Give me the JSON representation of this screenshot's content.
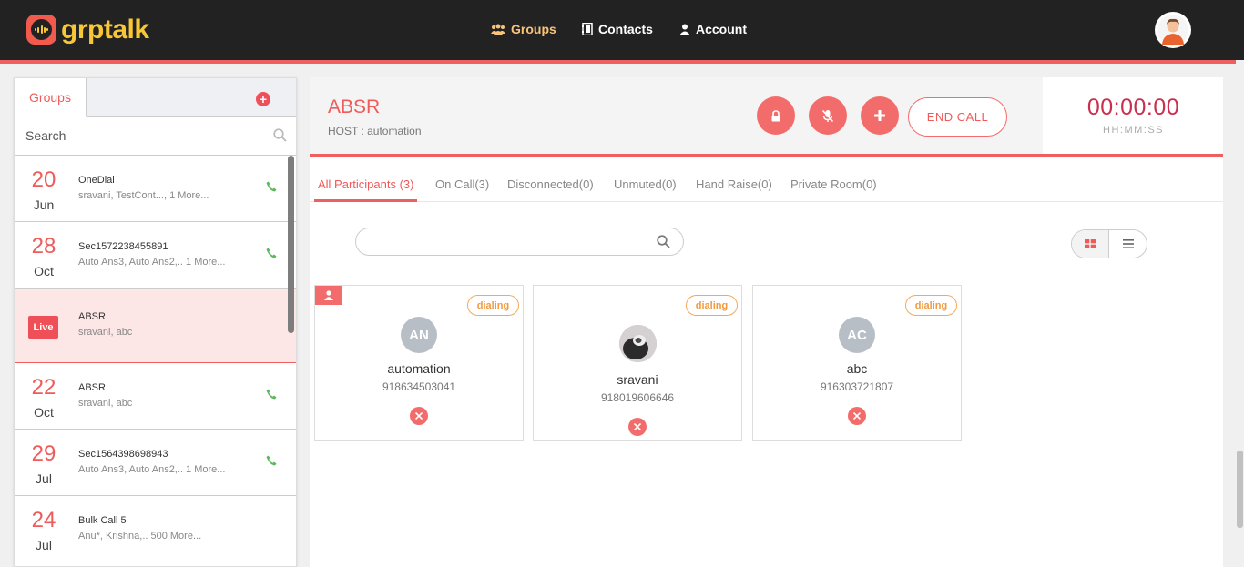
{
  "app": {
    "name": "grptalk"
  },
  "nav": {
    "groups": "Groups",
    "contacts": "Contacts",
    "account": "Account"
  },
  "sidebar": {
    "tab_label": "Groups",
    "search_placeholder": "Search",
    "items": [
      {
        "day": "20",
        "month": "Jun",
        "name": "OneDial",
        "members": "sravani, TestCont..., 1 More..."
      },
      {
        "day": "28",
        "month": "Oct",
        "name": "Sec1572238455891",
        "members": "Auto Ans3, Auto Ans2,.. 1 More..."
      },
      {
        "badge": "Live",
        "name": "ABSR",
        "members": "sravani, abc"
      },
      {
        "day": "22",
        "month": "Oct",
        "name": "ABSR",
        "members": "sravani, abc"
      },
      {
        "day": "29",
        "month": "Jul",
        "name": "Sec1564398698943",
        "members": "Auto Ans3, Auto Ans2,.. 1 More..."
      },
      {
        "day": "24",
        "month": "Jul",
        "name": "Bulk Call 5",
        "members": "Anu*, Krishna,.. 500 More..."
      }
    ]
  },
  "call": {
    "title": "ABSR",
    "host": "HOST : automation",
    "end_call": "END CALL",
    "timer": "00:00:00",
    "timer_label": "HH:MM:SS"
  },
  "participant_tabs": [
    "All Participants (3)",
    "On Call(3)",
    "Disconnected(0)",
    "Unmuted(0)",
    "Hand Raise(0)",
    "Private Room(0)"
  ],
  "participants": [
    {
      "initials": "AN",
      "name": "automation",
      "phone": "918634503041",
      "status": "dialing",
      "is_host": true
    },
    {
      "name": "sravani",
      "phone": "918019606646",
      "status": "dialing",
      "has_photo": true
    },
    {
      "initials": "AC",
      "name": "abc",
      "phone": "916303721807",
      "status": "dialing"
    }
  ],
  "colors": {
    "accent": "#ef5a5a",
    "brand_yellow": "#f8c735",
    "topbar": "#222222",
    "status_orange": "#f39a3d"
  }
}
